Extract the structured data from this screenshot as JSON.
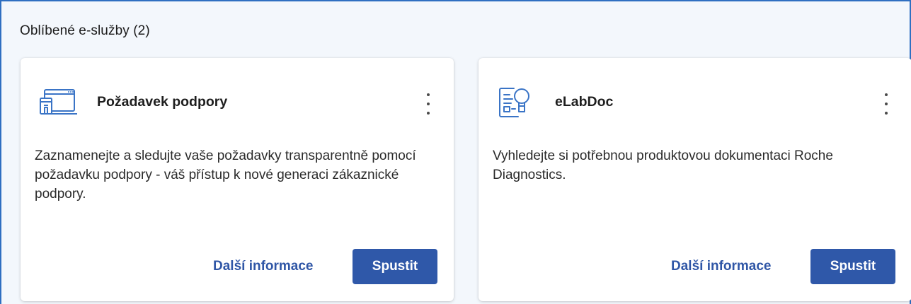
{
  "section": {
    "title": "Oblíbené e-služby (2)"
  },
  "cards": [
    {
      "title": "Požadavek podpory",
      "icon": "support-request-icon",
      "description": "Zaznamenejte a sledujte vaše požadavky transparentně pomocí požadavku podpory - váš přístup k nové generaci zákaznické podpory.",
      "info_label": "Další informace",
      "run_label": "Spustit"
    },
    {
      "title": "eLabDoc",
      "icon": "document-search-icon",
      "description": "Vyhledejte si potřebnou produktovou dokumentaci Roche Diagnostics.",
      "info_label": "Další informace",
      "run_label": "Spustit"
    }
  ],
  "colors": {
    "accent": "#2f58a9",
    "link": "#2f56a6",
    "panel_border": "#2f6fc1",
    "icon": "#3a74c6"
  }
}
